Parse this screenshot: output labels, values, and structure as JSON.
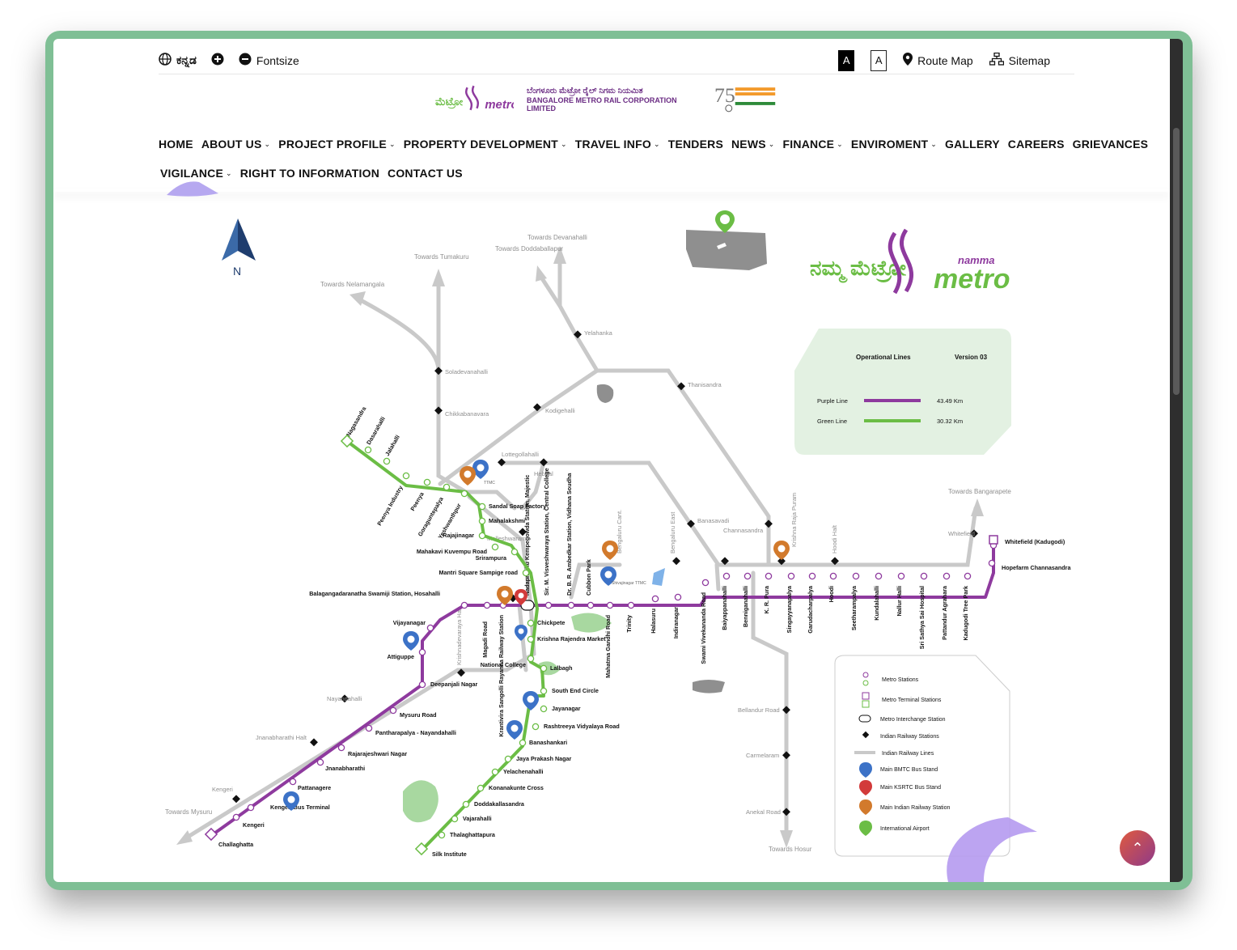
{
  "topbar": {
    "language": "ಕನ್ನಡ",
    "fontsize": "Fontsize",
    "contrast_dark": "A",
    "contrast_light": "A",
    "route_map": "Route Map",
    "sitemap": "Sitemap"
  },
  "logo": {
    "metro_word": "metro",
    "namma": "namma",
    "kannada_name": "ಬೆಂಗಳೂರು ಮೆಟ್ರೋ ರೈಲ್ ನಿಗಮ ನಿಯಮಿತ",
    "english_name": "BANGALORE METRO RAIL CORPORATION LIMITED",
    "azadi": "Azadi Ka Amrit Mahotsav"
  },
  "nav": {
    "row1": [
      {
        "label": "HOME",
        "dropdown": false
      },
      {
        "label": "ABOUT US",
        "dropdown": true
      },
      {
        "label": "PROJECT PROFILE",
        "dropdown": true
      },
      {
        "label": "PROPERTY DEVELOPMENT",
        "dropdown": true
      },
      {
        "label": "TRAVEL INFO",
        "dropdown": true
      },
      {
        "label": "TENDERS",
        "dropdown": false
      },
      {
        "label": "NEWS",
        "dropdown": true
      },
      {
        "label": "FINANCE",
        "dropdown": true
      },
      {
        "label": "ENVIROMENT",
        "dropdown": true
      },
      {
        "label": "GALLERY",
        "dropdown": false
      },
      {
        "label": "CAREERS",
        "dropdown": false
      },
      {
        "label": "GRIEVANCES",
        "dropdown": false
      }
    ],
    "row2": [
      {
        "label": "VIGILANCE",
        "dropdown": true
      },
      {
        "label": "RIGHT TO INFORMATION",
        "dropdown": false
      },
      {
        "label": "CONTACT US",
        "dropdown": false
      }
    ]
  },
  "map": {
    "north": "N",
    "brand_kannada": "ನಮ್ಮ ಮೆಟ್ರೋ",
    "brand_namma": "namma",
    "brand_metro": "metro",
    "operational_lines": {
      "title": "Operational Lines",
      "version": "Version  03",
      "purple_label": "Purple Line",
      "purple_km": "43.49 Km",
      "green_label": "Green Line",
      "green_km": "30.32 Km"
    },
    "legend": [
      "Metro Stations",
      "Metro Terminal Stations",
      "Metro Interchange Station",
      "Indian Railway Stations",
      "Indian Railway Lines",
      "Main BMTC Bus Stand",
      "Main KSRTC Bus Stand",
      "Main Indian Railway Station",
      "International Airport"
    ],
    "directions": {
      "devanahalli": "Towards Devanahalli",
      "doddaballapur": "Towards Doddaballapur",
      "tumakuru": "Towards Tumakuru",
      "nelamangala": "Towards Nelamangala",
      "bangarapete": "Towards Bangarapete",
      "hosur": "Towards Hosur",
      "mysuru": "Towards Mysuru"
    },
    "railway_stations": {
      "yelahanka": "Yelahanka",
      "soladevanahalli": "Soladevanahalli",
      "chikkabanavara": "Chikkabanavara",
      "kodigehalli": "Kodigehalli",
      "thanisandra": "Thanisandra",
      "lottegollahalli": "Lottegollahalli",
      "hebbal": "Hebbal",
      "banasavadi": "Banasavadi",
      "channasandra": "Channasandra",
      "whitefield": "Whitefield",
      "hoodi_halt": "Hoodi Halt",
      "krishna_raja_puram": "Krishna Raja Puram",
      "bengaluru_east": "Bengaluru East",
      "bengaluru_cant": "Bengaluru Cant.",
      "malleshwaram": "Malleshwaram",
      "krishnadevaraya_halt": "Krishnadevaraya Halt",
      "nayandahalli": "Nayandahalli",
      "jnanabharathi_halt": "Jnanabharathi Halt",
      "kengeri": "Kengeri",
      "bellandur_road": "Bellandur Road",
      "carmelaram": "Carmelaram",
      "anekal_road": "Anekal Road"
    },
    "green_line": [
      "Nagasandra",
      "Dasarahalli",
      "Jalahalli",
      "Peenya Industry",
      "Peenya",
      "Goraguntepalya",
      "Yeshwanthpur",
      "Sandal Soap Factory",
      "Mahalakshmi",
      "Rajajinagar",
      "Mahakavi Kuvempu Road",
      "Srirampura",
      "Mantri Square Sampige road",
      "Chickpete",
      "Krishna Rajendra Market",
      "National College",
      "Lalbagh",
      "South End Circle",
      "Jayanagar",
      "Rashtreeya Vidyalaya Road",
      "Banashankari",
      "Jaya Prakash Nagar",
      "Yelachenahalli",
      "Konanakunte Cross",
      "Doddakallasandra",
      "Vajarahalli",
      "Thalaghattapura",
      "Silk Institute"
    ],
    "purple_line": [
      "Challaghatta",
      "Kengeri",
      "Kengeri Bus Terminal",
      "Pattanagere",
      "Jnanabharathi",
      "Rajarajeshwari Nagar",
      "Pantharapalya - Nayandahalli",
      "Mysuru Road",
      "Deepanjali Nagar",
      "Attiguppe",
      "Vijayanagar",
      "Balagangadaranatha Swamiji Station, Hosahalli",
      "Magadi Road",
      "Krantivira Sangolli Rayanna Railway Station",
      "Nadaprabhu Kempegowda Station, Majestic",
      "Sir. M. Visveshwaraya Station, Central College",
      "Dr. B. R. Ambedkar Station, Vidhana Soudha",
      "Cubbon Park",
      "Mahatma Gandhi Road",
      "Trinity",
      "Halasuru",
      "Indiranagar",
      "Swami Vivekananda Road",
      "Baiyappanahalli",
      "Benniganahalli",
      "K. R. Pura",
      "Singayyanapalya",
      "Garudacharpalya",
      "Hoodi",
      "Seetharampalya",
      "Kundalahalli",
      "Nallur Halli",
      "Sri Sathya Sai Hospital",
      "Pattandur Agrahara",
      "Kadugodi Tree Park",
      "Hopefarm Channasandra",
      "Whitefield (Kadugodi)"
    ],
    "labels_misc": {
      "ttmc": "TTMC",
      "shivajinagar": "Shivajinagar TTMC"
    }
  },
  "colors": {
    "purple": "#8e3a9e",
    "green": "#6bbd45",
    "rail": "#c9c9c9",
    "frame": "#7fbf95",
    "panel": "#e3f1e2"
  }
}
